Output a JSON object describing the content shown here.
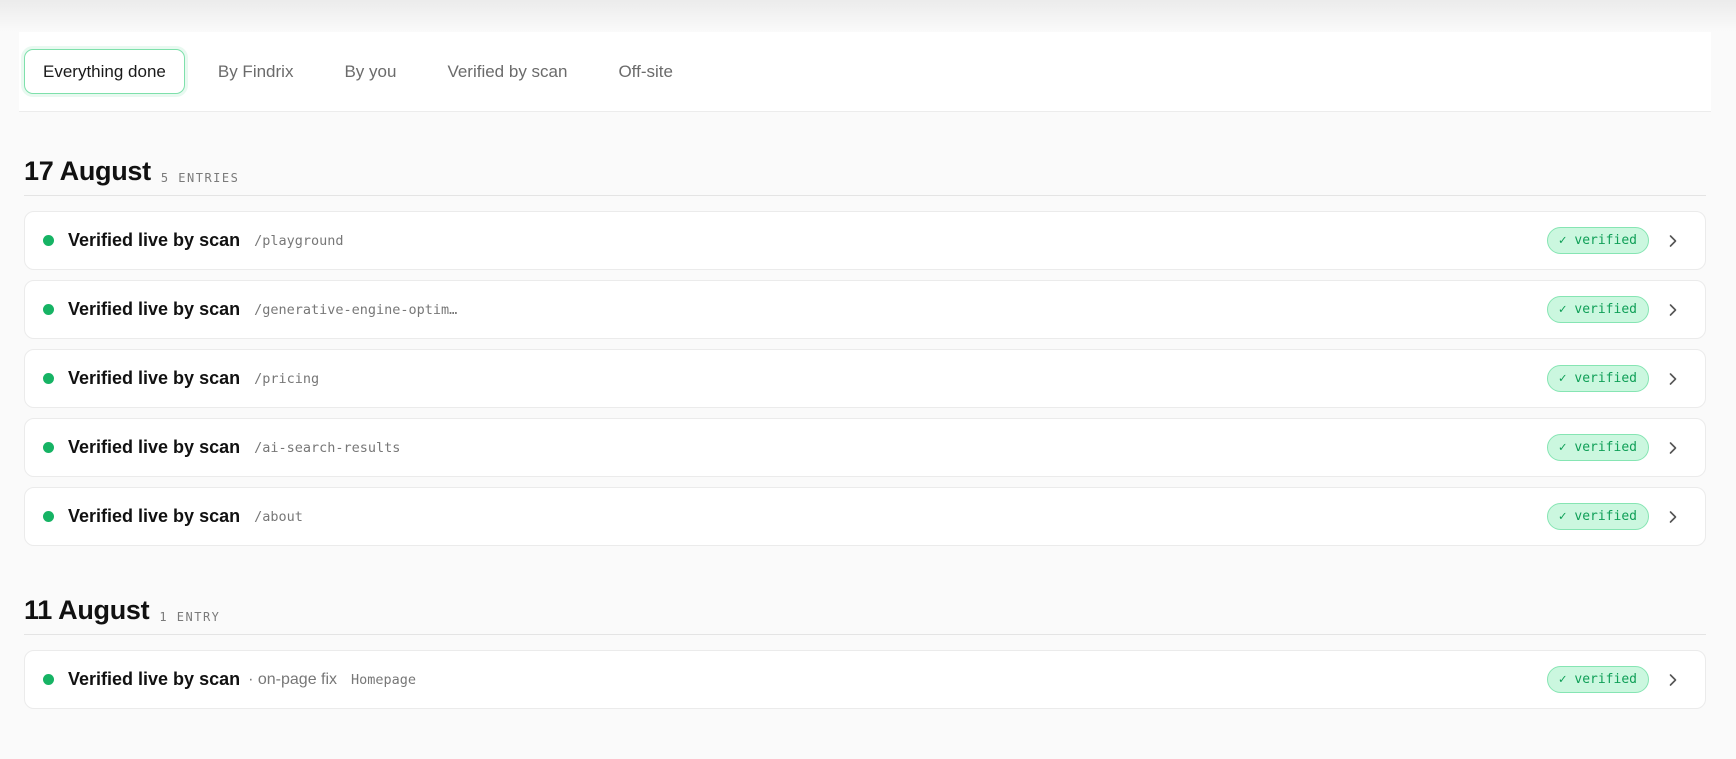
{
  "tabs": [
    {
      "label": "Everything done",
      "active": true
    },
    {
      "label": "By Findrix",
      "active": false
    },
    {
      "label": "By you",
      "active": false
    },
    {
      "label": "Verified by scan",
      "active": false
    },
    {
      "label": "Off-site",
      "active": false
    }
  ],
  "sections": [
    {
      "title": "17 August",
      "count": "5 ENTRIES",
      "rows": [
        {
          "title": "Verified live by scan",
          "sub": "",
          "path": "/playground",
          "badge": "✓ verified"
        },
        {
          "title": "Verified live by scan",
          "sub": "",
          "path": "/generative-engine-optim…",
          "badge": "✓ verified"
        },
        {
          "title": "Verified live by scan",
          "sub": "",
          "path": "/pricing",
          "badge": "✓ verified"
        },
        {
          "title": "Verified live by scan",
          "sub": "",
          "path": "/ai-search-results",
          "badge": "✓ verified"
        },
        {
          "title": "Verified live by scan",
          "sub": "",
          "path": "/about",
          "badge": "✓ verified"
        }
      ]
    },
    {
      "title": "11 August",
      "count": "1 ENTRY",
      "rows": [
        {
          "title": "Verified live by scan",
          "sub": "· on-page fix",
          "path": "Homepage",
          "badge": "✓ verified"
        }
      ]
    }
  ],
  "colors": {
    "accent": "#16b364",
    "badge_bg": "#cbf7df",
    "badge_border": "#86e5b3",
    "active_tab_border": "#7ee0ab"
  },
  "icons": {
    "status": "status-dot-icon",
    "row_action": "chevron-right-icon"
  }
}
